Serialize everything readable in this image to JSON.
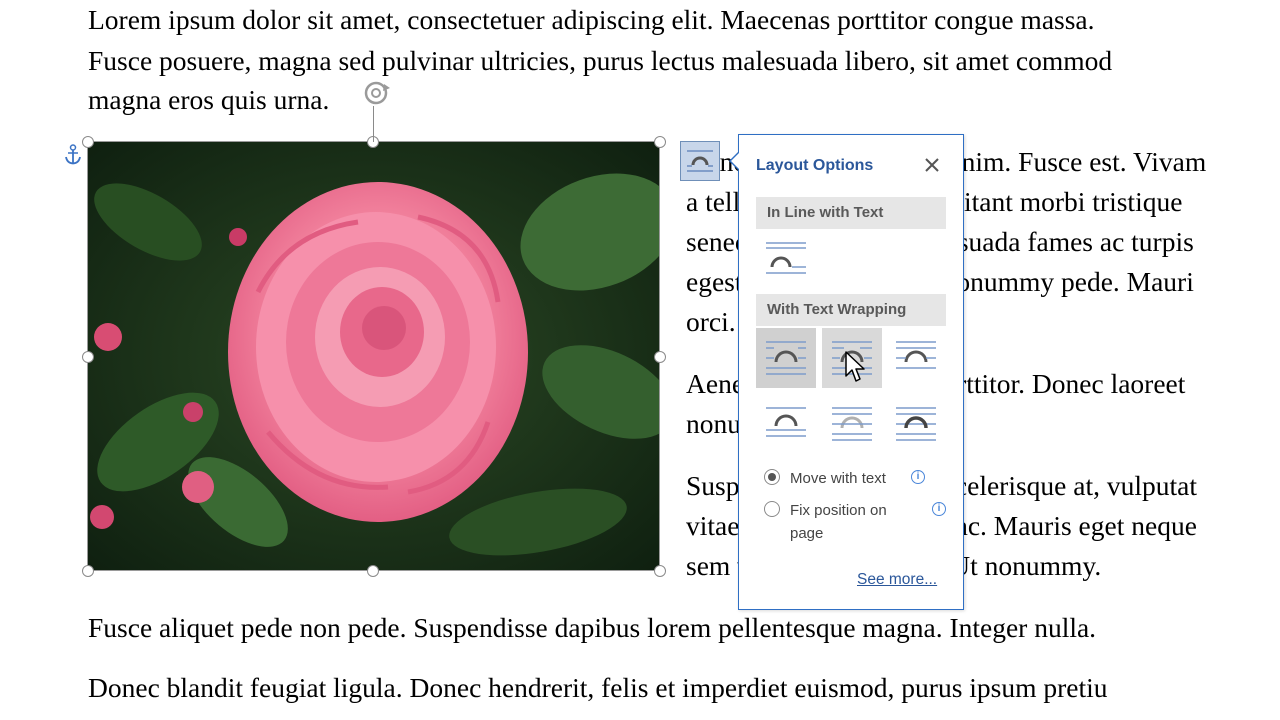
{
  "document": {
    "paragraph1": [
      "Lorem ipsum dolor sit amet, consectetuer adipiscing elit. Maecenas porttitor congue massa.",
      "Fusce posuere, magna sed pulvinar ultricies, purus lectus malesuada libero, sit amet commod",
      "magna eros quis urna."
    ],
    "right_column": [
      "Nunc viverra imperdiet enim. Fusce est. Vivam",
      "a tellus. Pellentesque habitant morbi tristique",
      "senectus et netus et malesuada fames ac turpis",
      "egestas. Proin pharetra nonummy pede. Mauri",
      "orci.",
      "Aenean nec lorem. In porttitor. Donec laoreet",
      "nonummy augue.",
      "Suspendisse dui purus, scelerisque at, vulputat",
      "vitae, pretium mattis, nunc. Mauris eget neque",
      "sem venenatis eleifend. Ut nonummy."
    ],
    "paragraph_after": "Fusce aliquet pede non pede. Suspendisse dapibus lorem pellentesque magna. Integer nulla.",
    "paragraph_last": "Donec blandit feugiat ligula. Donec hendrerit, felis et imperdiet euismod, purus ipsum pretiu"
  },
  "picture": {
    "description_icon": "rose-photo"
  },
  "layout_options": {
    "title": "Layout Options",
    "inline_section": "In Line with Text",
    "wrapping_section": "With Text Wrapping",
    "radio_move": "Move with text",
    "radio_fix_line1": "Fix position on",
    "radio_fix_line2": "page",
    "see_more": "See more...",
    "selected_radio": "move",
    "colors": {
      "accent": "#2b579a",
      "border": "#2f6fc4",
      "section_bg": "#e6e6e6"
    }
  }
}
